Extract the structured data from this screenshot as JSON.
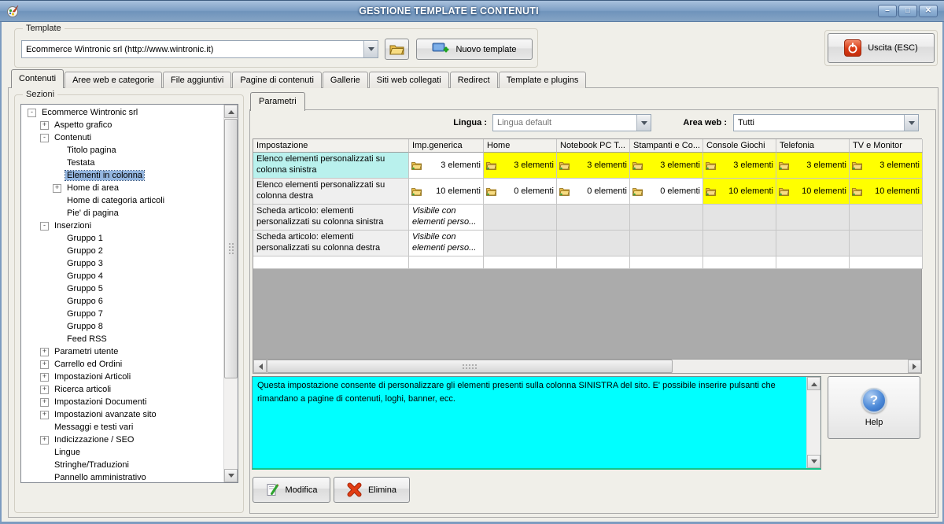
{
  "window": {
    "title": "GESTIONE TEMPLATE E CONTENUTI"
  },
  "template_box": {
    "label": "Template",
    "combo_value": "Ecommerce Wintronic srl (http://www.wintronic.it)",
    "new_button_label": "Nuovo template"
  },
  "exit": {
    "label": "Uscita (ESC)"
  },
  "tabs": {
    "active": 0,
    "items": [
      "Contenuti",
      "Aree web e categorie",
      "File aggiuntivi",
      "Pagine di contenuti",
      "Gallerie",
      "Siti web collegati",
      "Redirect",
      "Template e plugins"
    ]
  },
  "sezioni": {
    "label": "Sezioni",
    "tree": [
      {
        "level": 0,
        "exp": "minus",
        "label": "Ecommerce Wintronic srl"
      },
      {
        "level": 1,
        "exp": "plus",
        "label": "Aspetto grafico"
      },
      {
        "level": 1,
        "exp": "minus",
        "label": "Contenuti"
      },
      {
        "level": 2,
        "exp": null,
        "label": "Titolo pagina"
      },
      {
        "level": 2,
        "exp": null,
        "label": "Testata"
      },
      {
        "level": 2,
        "exp": null,
        "label": "Elementi in colonna",
        "selected": true
      },
      {
        "level": 2,
        "exp": "plus",
        "label": "Home di area"
      },
      {
        "level": 2,
        "exp": null,
        "label": "Home di categoria articoli"
      },
      {
        "level": 2,
        "exp": null,
        "label": "Pie' di pagina"
      },
      {
        "level": 1,
        "exp": "minus",
        "label": "Inserzioni"
      },
      {
        "level": 2,
        "exp": null,
        "label": "Gruppo 1"
      },
      {
        "level": 2,
        "exp": null,
        "label": "Gruppo 2"
      },
      {
        "level": 2,
        "exp": null,
        "label": "Gruppo 3"
      },
      {
        "level": 2,
        "exp": null,
        "label": "Gruppo 4"
      },
      {
        "level": 2,
        "exp": null,
        "label": "Gruppo 5"
      },
      {
        "level": 2,
        "exp": null,
        "label": "Gruppo 6"
      },
      {
        "level": 2,
        "exp": null,
        "label": "Gruppo 7"
      },
      {
        "level": 2,
        "exp": null,
        "label": "Gruppo 8"
      },
      {
        "level": 2,
        "exp": null,
        "label": "Feed RSS"
      },
      {
        "level": 1,
        "exp": "plus",
        "label": "Parametri utente"
      },
      {
        "level": 1,
        "exp": "plus",
        "label": "Carrello ed Ordini"
      },
      {
        "level": 1,
        "exp": "plus",
        "label": "Impostazioni Articoli"
      },
      {
        "level": 1,
        "exp": "plus",
        "label": "Ricerca articoli"
      },
      {
        "level": 1,
        "exp": "plus",
        "label": "Impostazioni Documenti"
      },
      {
        "level": 1,
        "exp": "plus",
        "label": "Impostazioni avanzate sito"
      },
      {
        "level": 1,
        "exp": null,
        "label": "Messaggi e testi vari"
      },
      {
        "level": 1,
        "exp": "plus",
        "label": "Indicizzazione / SEO"
      },
      {
        "level": 1,
        "exp": null,
        "label": "Lingue"
      },
      {
        "level": 1,
        "exp": null,
        "label": "Stringhe/Traduzioni"
      },
      {
        "level": 1,
        "exp": null,
        "label": "Pannello amministrativo"
      }
    ]
  },
  "params": {
    "tab_label": "Parametri",
    "lingua_label": "Lingua :",
    "lingua_value": "Lingua default",
    "area_label": "Area web :",
    "area_value": "Tutti"
  },
  "table": {
    "columns": [
      "Impostazione",
      "Imp.generica",
      "Home",
      "Notebook  PC T...",
      "Stampanti e Co...",
      "Console Giochi",
      "Telefonia",
      "TV e Monitor"
    ],
    "rows": [
      {
        "label": "Elenco elementi personalizzati su colonna sinistra",
        "label_bg": "cyan",
        "cells": [
          {
            "text": "3 elementi",
            "folder": true,
            "bg": "white"
          },
          {
            "text": "3 elementi",
            "folder": true,
            "bg": "yellow"
          },
          {
            "text": "3 elementi",
            "folder": true,
            "bg": "yellow"
          },
          {
            "text": "3 elementi",
            "folder": true,
            "bg": "yellow"
          },
          {
            "text": "3 elementi",
            "folder": true,
            "bg": "yellow"
          },
          {
            "text": "3 elementi",
            "folder": true,
            "bg": "yellow"
          },
          {
            "text": "3 elementi",
            "folder": true,
            "bg": "yellow"
          }
        ]
      },
      {
        "label": "Elenco elementi personalizzati su colonna destra",
        "label_bg": "plain",
        "cells": [
          {
            "text": "10 elementi",
            "folder": true,
            "bg": "white"
          },
          {
            "text": "0 elementi",
            "folder": true,
            "bg": "white"
          },
          {
            "text": "0 elementi",
            "folder": true,
            "bg": "white"
          },
          {
            "text": "0 elementi",
            "folder": true,
            "bg": "white"
          },
          {
            "text": "10 elementi",
            "folder": true,
            "bg": "yellow"
          },
          {
            "text": "10 elementi",
            "folder": true,
            "bg": "yellow"
          },
          {
            "text": "10 elementi",
            "folder": true,
            "bg": "yellow"
          }
        ]
      },
      {
        "label": "Scheda articolo: elementi personalizzati su colonna sinistra",
        "label_bg": "plain",
        "cells": [
          {
            "text": "Visibile con elementi perso...",
            "folder": false,
            "bg": "white",
            "italic": true
          },
          {
            "text": "",
            "bg": "gray"
          },
          {
            "text": "",
            "bg": "gray"
          },
          {
            "text": "",
            "bg": "gray"
          },
          {
            "text": "",
            "bg": "gray"
          },
          {
            "text": "",
            "bg": "gray"
          },
          {
            "text": "",
            "bg": "gray"
          }
        ]
      },
      {
        "label": "Scheda articolo: elementi personalizzati su colonna destra",
        "label_bg": "plain",
        "cells": [
          {
            "text": "Visibile con elementi perso...",
            "folder": false,
            "bg": "white",
            "italic": true
          },
          {
            "text": "",
            "bg": "gray"
          },
          {
            "text": "",
            "bg": "gray"
          },
          {
            "text": "",
            "bg": "gray"
          },
          {
            "text": "",
            "bg": "gray"
          },
          {
            "text": "",
            "bg": "gray"
          },
          {
            "text": "",
            "bg": "gray"
          }
        ]
      }
    ]
  },
  "description": {
    "text": "Questa impostazione consente di personalizzare gli elementi presenti sulla colonna SINISTRA del sito. E' possibile inserire pulsanti che rimandano a pagine di contenuti, loghi, banner, ecc."
  },
  "actions": {
    "modifica": "Modifica",
    "elimina": "Elimina",
    "help": "Help"
  }
}
